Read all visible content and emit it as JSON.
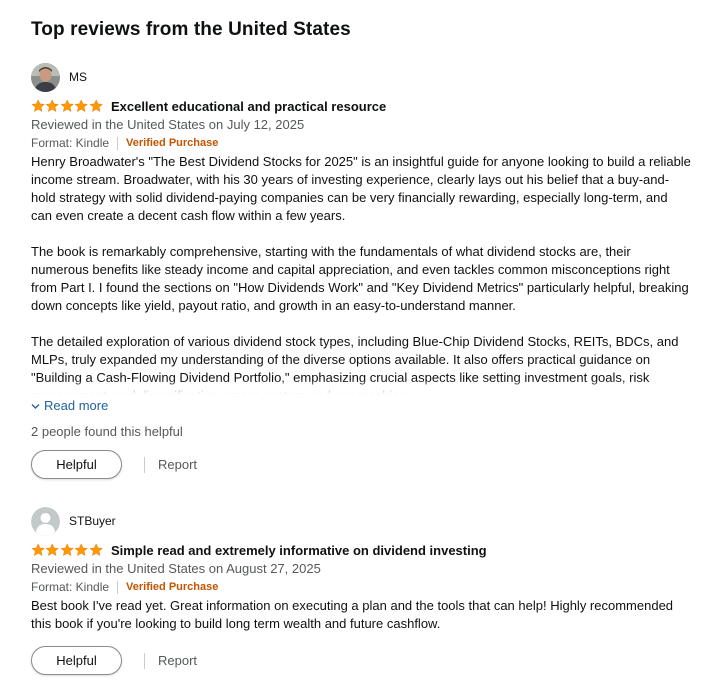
{
  "section": {
    "title": "Top reviews from the United States"
  },
  "colors": {
    "star": "#ff9900",
    "verified": "#c45500",
    "link": "#2162a1",
    "muted": "#565959"
  },
  "reviews": [
    {
      "profile_name": "MS",
      "avatar_icon": "user-photo-avatar",
      "rating": 5,
      "title": "Excellent educational and practical resource",
      "date_line": "Reviewed in the United States on July 12, 2025",
      "format": "Format: Kindle",
      "verified": "Verified Purchase",
      "paragraphs": [
        "Henry Broadwater's \"The Best Dividend Stocks for 2025\" is an insightful guide for anyone looking to build a reliable income stream. Broadwater, with his 30 years of investing experience, clearly lays out his belief that a buy-and-hold strategy with solid dividend-paying companies can be very financially rewarding, especially long-term, and can even create a decent cash flow within a few years.",
        "The book is remarkably comprehensive, starting with the fundamentals of what dividend stocks are, their numerous benefits like steady income and capital appreciation, and even tackles common misconceptions right from Part I. I found the sections on \"How Dividends Work\" and \"Key Dividend Metrics\" particularly helpful, breaking down concepts like yield, payout ratio, and growth in an easy-to-understand manner.",
        "The detailed exploration of various dividend stock types, including Blue-Chip Dividend Stocks, REITs, BDCs, and MLPs, truly expanded my understanding of the diverse options available. It also offers practical guidance on \"Building a Cash-Flowing Dividend Portfolio,\" emphasizing crucial aspects like setting investment goals, risk management, and diversification across sectors and geographies."
      ],
      "read_more": "Read more",
      "helpful_count": "2 people found this helpful",
      "helpful_button": "Helpful",
      "report": "Report"
    },
    {
      "profile_name": "STBuyer",
      "avatar_icon": "default-user-avatar",
      "rating": 5,
      "title": "Simple read and extremely informative on dividend investing",
      "date_line": "Reviewed in the United States on August 27, 2025",
      "format": "Format: Kindle",
      "verified": "Verified Purchase",
      "paragraphs": [
        "Best book I've read yet. Great information on executing a plan and the tools that can help! Highly recommended this book if you're looking to build long term wealth and future cashflow."
      ],
      "helpful_button": "Helpful",
      "report": "Report"
    }
  ]
}
